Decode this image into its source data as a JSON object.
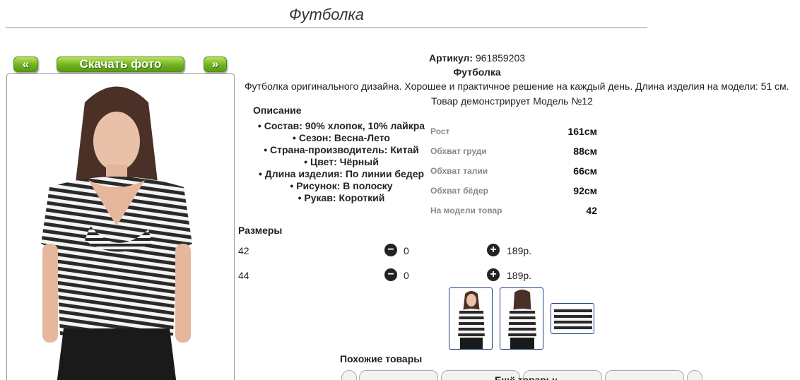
{
  "page": {
    "title": "Футболка"
  },
  "gallery": {
    "prev_label": "«",
    "download_label": "Скачать фото",
    "next_label": "»"
  },
  "product": {
    "article_label": "Артикул:",
    "article_value": "961859203",
    "name": "Футболка",
    "description": "Футболка оригинального дизайна. Хорошее и практичное решение на каждый день. Длина изделия на модели: 51 см.",
    "model_note": "Товар демонстрирует Модель №12"
  },
  "description_section": {
    "heading": "Описание",
    "items": [
      "Состав: 90% хлопок, 10% лайкра",
      "Сезон: Весна-Лето",
      "Страна-производитель: Китай",
      "Цвет: Чёрный",
      "Длина изделия: По линии бедер",
      "Рисунок: В полоску",
      "Рукав: Короткий"
    ]
  },
  "measurements": [
    {
      "label": "Рост",
      "value": "161см"
    },
    {
      "label": "Обхват груди",
      "value": "88см"
    },
    {
      "label": "Обхват талии",
      "value": "66см"
    },
    {
      "label": "Обхват бёдер",
      "value": "92см"
    },
    {
      "label": "На модели товар",
      "value": "42"
    }
  ],
  "sizes": {
    "heading": "Размеры",
    "rows": [
      {
        "size": "42",
        "qty": "0",
        "price": "189р."
      },
      {
        "size": "44",
        "qty": "0",
        "price": "189р."
      }
    ]
  },
  "similar": {
    "heading": "Похожие товары",
    "more_label": "Ещё товары:"
  },
  "colors": {
    "accent_green": "#6fb321",
    "thumb_border": "#1a3c80"
  }
}
